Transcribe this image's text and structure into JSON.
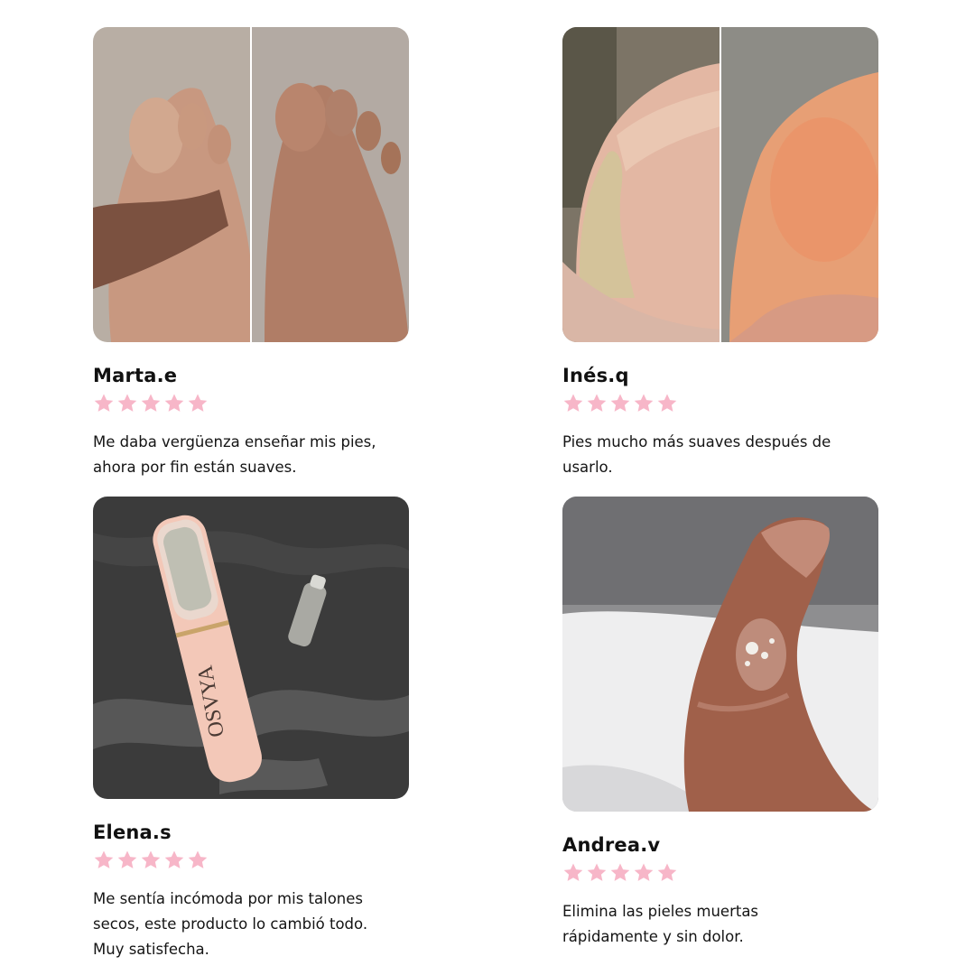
{
  "accent_star_color": "#f7b6c8",
  "reviews": [
    {
      "name": "Marta.e",
      "rating": 5,
      "text": "Me daba vergüenza enseñar mis pies,\nahora por fin están suaves.",
      "photo_icon": "before-after-toes-photo"
    },
    {
      "name": "Inés.q",
      "rating": 5,
      "text": "Pies mucho más suaves después de\nusarlo.",
      "photo_icon": "before-after-heel-photo"
    },
    {
      "name": "Elena.s",
      "rating": 5,
      "text": "Me sentía incómoda por mis talones\nsecos, este producto lo cambió todo.\nMuy satisfecha.",
      "photo_icon": "foot-file-device-photo",
      "product_brand": "OSVYA"
    },
    {
      "name": "Andrea.v",
      "rating": 5,
      "text": "Elimina las pieles muertas\nrápidamente y sin dolor.",
      "photo_icon": "foot-dead-skin-photo"
    }
  ]
}
